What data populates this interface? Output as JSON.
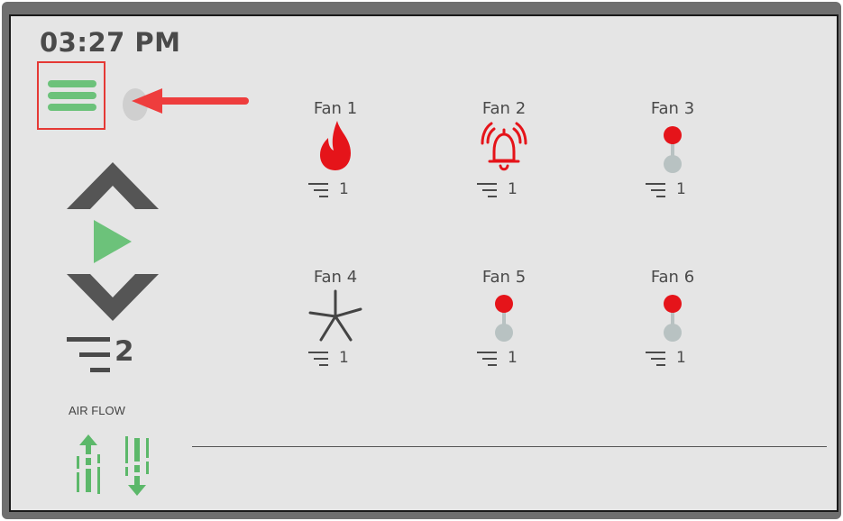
{
  "header": {
    "time": "03:27 PM"
  },
  "menu": {
    "icon": "hamburger-menu-icon",
    "color": "#6cc27a",
    "highlight": "#e53935"
  },
  "annotation": {
    "arrow_color": "#ee3d3d"
  },
  "controls": {
    "up_icon": "chevron-up-icon",
    "play_icon": "play-icon",
    "down_icon": "chevron-down-icon",
    "speed_icon": "speed-lines-icon",
    "speed_level": "2"
  },
  "airflow": {
    "label": "AIR FLOW",
    "up_icon": "airflow-up-icon",
    "down_icon": "airflow-down-icon",
    "color": "#5cb86a"
  },
  "fans": [
    {
      "name": "Fan 1",
      "status": "fire",
      "icon": "flame-icon",
      "speed": "1"
    },
    {
      "name": "Fan 2",
      "status": "alarm",
      "icon": "alarm-bell-icon",
      "speed": "1"
    },
    {
      "name": "Fan 3",
      "status": "off",
      "icon": "toggle-icon",
      "speed": "1"
    },
    {
      "name": "Fan 4",
      "status": "running",
      "icon": "fan-blades-icon",
      "speed": "1"
    },
    {
      "name": "Fan 5",
      "status": "off",
      "icon": "toggle-icon",
      "speed": "1"
    },
    {
      "name": "Fan 6",
      "status": "off",
      "icon": "toggle-icon",
      "speed": "1"
    }
  ],
  "colors": {
    "alert": "#e5141a",
    "text": "#4a4a4a",
    "accent_green": "#6cc27a"
  }
}
